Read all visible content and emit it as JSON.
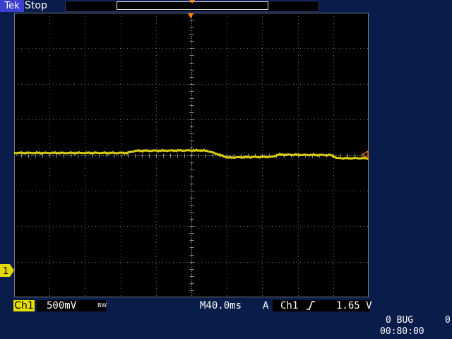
{
  "header": {
    "logo": "Tek",
    "run_status": "Stop"
  },
  "channel": {
    "marker": "1",
    "badge": "Ch1",
    "scale": "500mV",
    "bandwidth": "BW",
    "color": "#e0d800"
  },
  "timebase": {
    "label": "M40.0ms"
  },
  "trigger": {
    "mode": "A",
    "source": "Ch1",
    "level": "1.65 V",
    "color": "#ff7f00"
  },
  "status": {
    "counter": "0 BUG",
    "counter_right": "0",
    "clock": "00:80:00"
  }
}
